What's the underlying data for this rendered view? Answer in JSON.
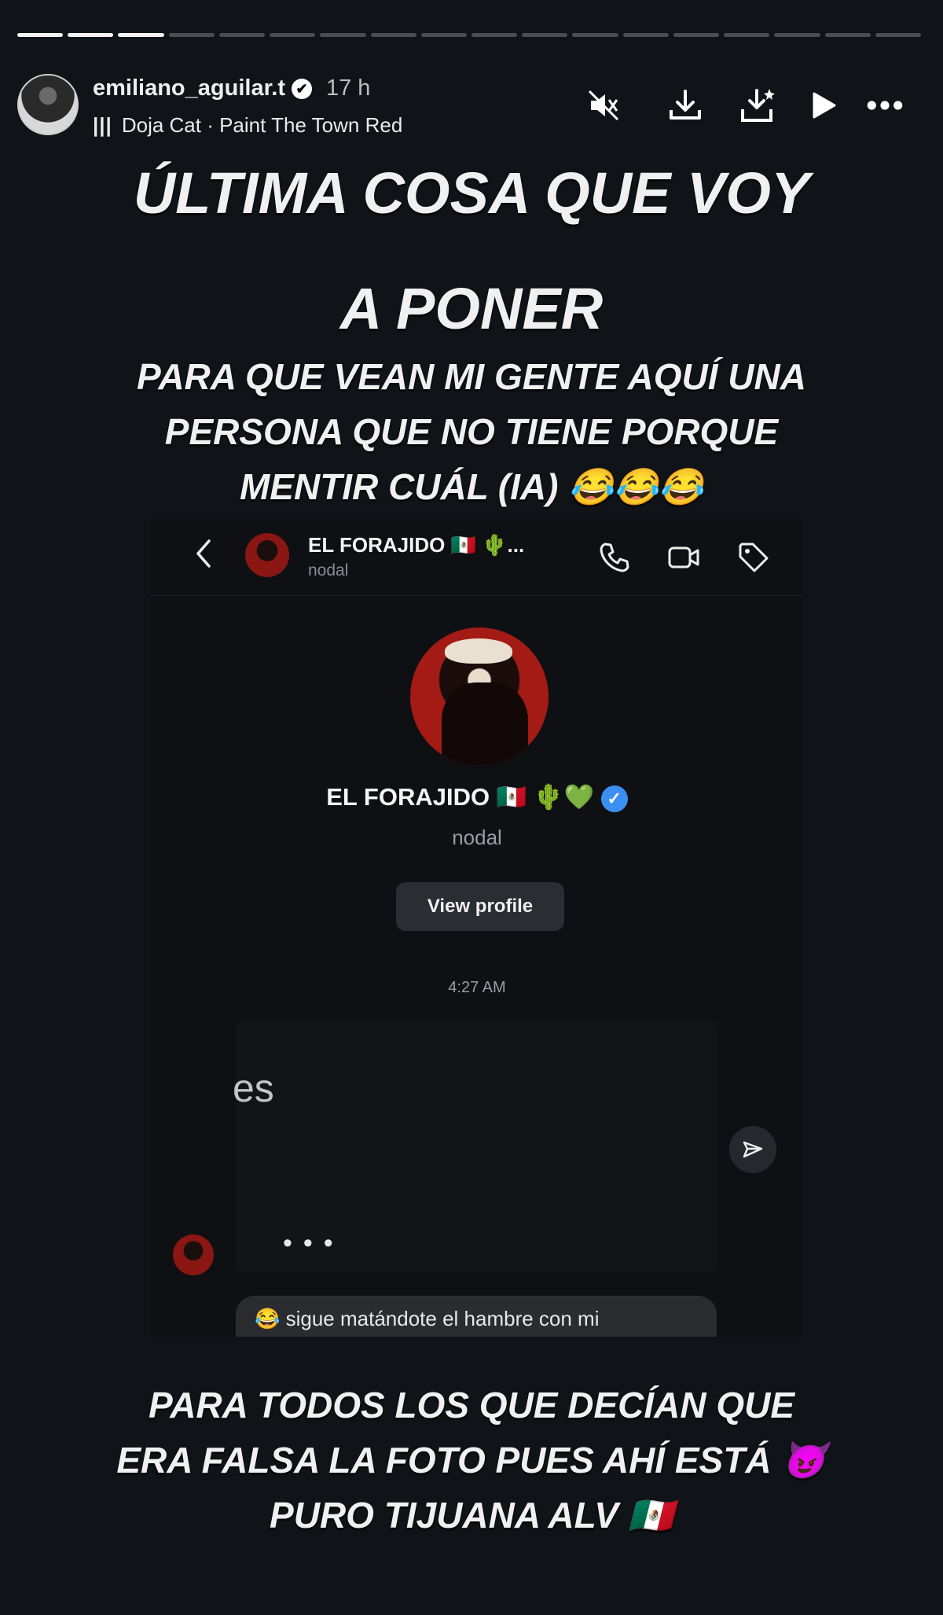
{
  "story": {
    "progress_total": 18,
    "progress_completed": 3,
    "user": {
      "username": "emiliano_aguilar.t",
      "verified_glyph": "✔",
      "time_ago": "17 h"
    },
    "music": {
      "icon": "equalizer-bars-icon",
      "artist": "Doja Cat",
      "separator": " · ",
      "song": "Paint The Town Red"
    },
    "header_icons": [
      "mute-icon",
      "download-icon",
      "save-icon",
      "play-icon",
      "more-icon"
    ]
  },
  "overlay_text": {
    "title_line1": "ÚLTIMA COSA QUE VOY",
    "title_line2": "A PONER",
    "sub_line1": "PARA QUE VEAN MI GENTE AQUÍ UNA",
    "sub_line2": "PERSONA QUE NO TIENE PORQUE",
    "sub_line3": "MENTIR CUÁL (IA) 😂😂😂",
    "bottom_line1": "PARA TODOS LOS QUE DECÍAN QUE",
    "bottom_line2": "ERA FALSA LA FOTO PUES AHÍ ESTÁ 😈",
    "bottom_line3": "PURO TIJUANA ALV 🇲🇽"
  },
  "dm": {
    "header_name": "EL FORAJIDO 🇲🇽 🌵...",
    "header_handle": "nodal",
    "profile_name": "EL FORAJIDO 🇲🇽 🌵💚",
    "verified_glyph": "✓",
    "profile_handle": "nodal",
    "view_profile_label": "View profile",
    "timestamp": "4:27 AM",
    "message_fragment": "es",
    "typing_dots": "•••",
    "reply_text": "😂 sigue matándote  el hambre con mi"
  },
  "colors": {
    "background": "#101317",
    "verified_blue": "#3a8ff0",
    "bubble": "#2a2c30"
  }
}
